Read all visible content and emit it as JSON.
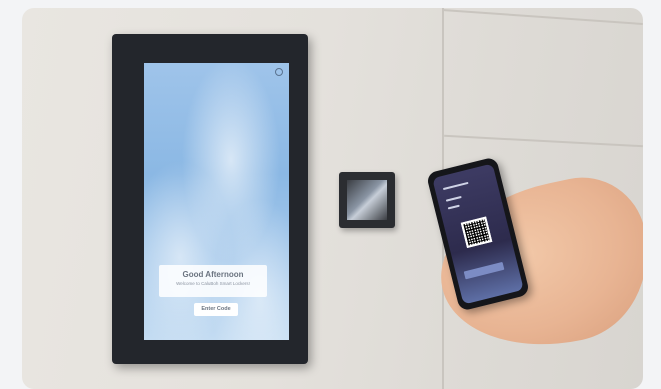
{
  "kiosk": {
    "brand": "",
    "time": "",
    "greeting": "Good Afternoon",
    "welcome": "Welcome to CaluBoh Smart Lockers!",
    "enter_code_label": "Enter Code"
  },
  "icons": [
    "gear-icon",
    "qr-code-icon"
  ],
  "colors": {
    "bezel": "#23262c",
    "sky": "#8bb8e4",
    "phone_screen": "#2d2b4d"
  }
}
